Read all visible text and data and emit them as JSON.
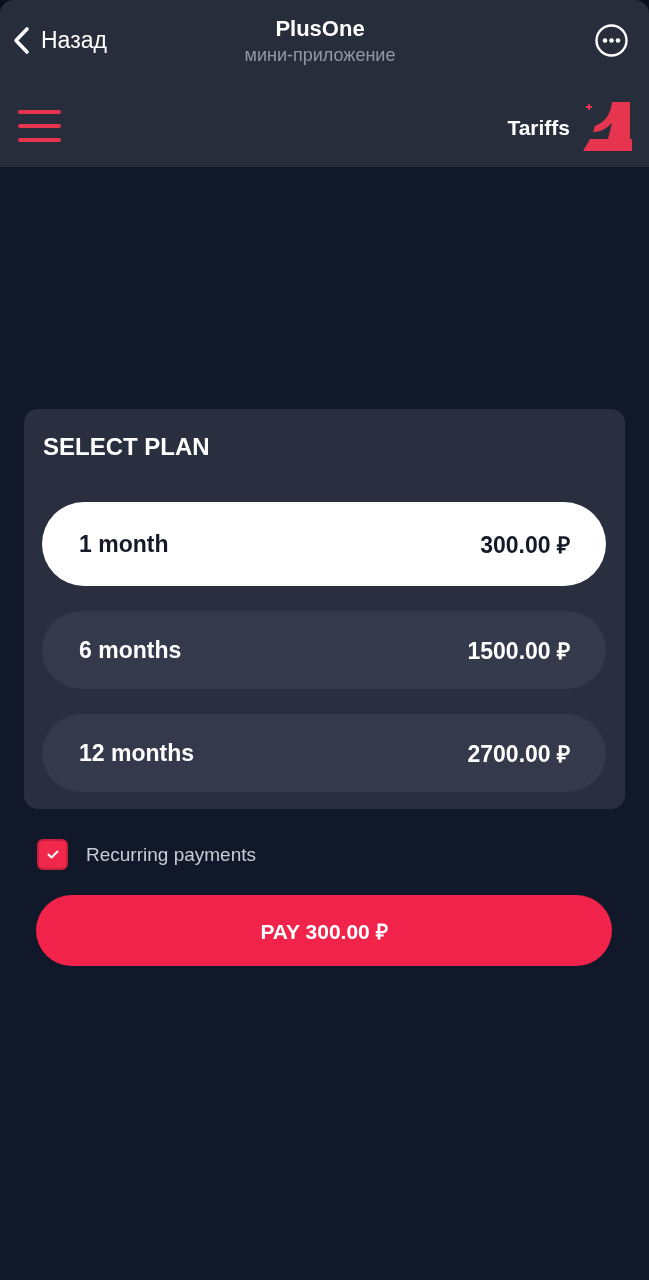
{
  "mini_app_bar": {
    "back_label": "Назад",
    "title": "PlusOne",
    "subtitle": "мини-приложение"
  },
  "header": {
    "title": "Tariffs"
  },
  "plan_card": {
    "title": "SELECT PLAN",
    "plans": [
      {
        "label": "1 month",
        "price": "300.00 ₽",
        "selected": true
      },
      {
        "label": "6 months",
        "price": "1500.00 ₽",
        "selected": false
      },
      {
        "label": "12 months",
        "price": "2700.00 ₽",
        "selected": false
      }
    ]
  },
  "recurring": {
    "label": "Recurring payments",
    "checked": true
  },
  "pay_button": {
    "label": "PAY 300.00 ₽"
  }
}
